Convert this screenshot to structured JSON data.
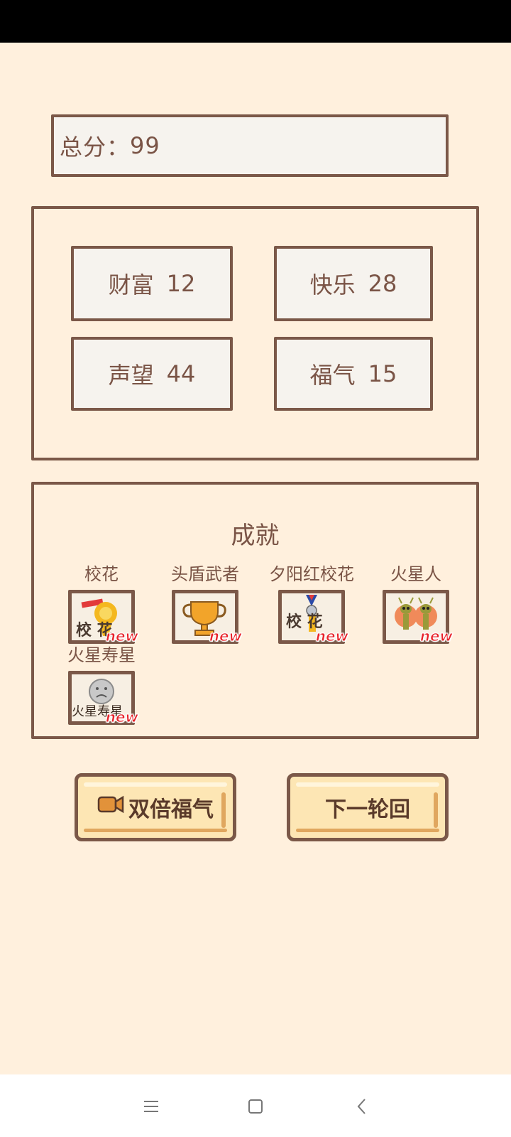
{
  "score": {
    "label": "总分：",
    "value": "99"
  },
  "stats": [
    {
      "name": "财富",
      "value": "12"
    },
    {
      "name": "快乐",
      "value": "28"
    },
    {
      "name": "声望",
      "value": "44"
    },
    {
      "name": "福气",
      "value": "15"
    }
  ],
  "achievements": {
    "title": "成就",
    "items": [
      {
        "label": "校花",
        "icon": "school-beauty-trophy-icon",
        "new_tag": "new",
        "art_text": "校 花"
      },
      {
        "label": "头盾武者",
        "icon": "gold-trophy-icon",
        "new_tag": "new"
      },
      {
        "label": "夕阳红校花",
        "icon": "medal-school-beauty-icon",
        "new_tag": "new",
        "art_text": "校 花"
      },
      {
        "label": "火星人",
        "icon": "martians-icon",
        "new_tag": "new"
      },
      {
        "label": "火星寿星",
        "icon": "sad-face-icon",
        "new_tag": "new",
        "art_text": "火星寿星"
      }
    ]
  },
  "buttons": {
    "double_luck": "双倍福气",
    "next_round": "下一轮回"
  },
  "colors": {
    "background": "#fff0dd",
    "border": "#7b5848",
    "text": "#7a5446",
    "button_fill": "#fde6b4",
    "new_tag": "#e8232a"
  },
  "nav": {
    "menu_icon": "menu-icon",
    "home_icon": "square-home-icon",
    "back_icon": "back-chevron-icon"
  }
}
